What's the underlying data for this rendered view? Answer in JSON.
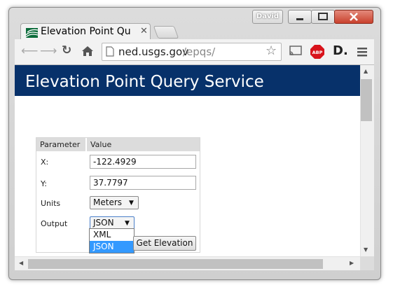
{
  "browser": {
    "profile_name": "David",
    "tab_title": "Elevation Point Query",
    "url_host": "ned.usgs.gov",
    "url_path": "/epqs/"
  },
  "page": {
    "banner_title": "Elevation Point Query Service",
    "table": {
      "col_parameter": "Parameter",
      "col_value": "Value",
      "x_label": "X:",
      "x_value": "-122.4929",
      "y_label": "Y:",
      "y_value": "37.7797",
      "units_label": "Units",
      "units_value": "Meters",
      "output_label": "Output",
      "output_value": "JSON",
      "output_options": [
        "XML",
        "JSON"
      ],
      "submit_label": "Get Elevation"
    }
  },
  "colors": {
    "banner": "#07316a",
    "selected_option": "#3399ff"
  }
}
